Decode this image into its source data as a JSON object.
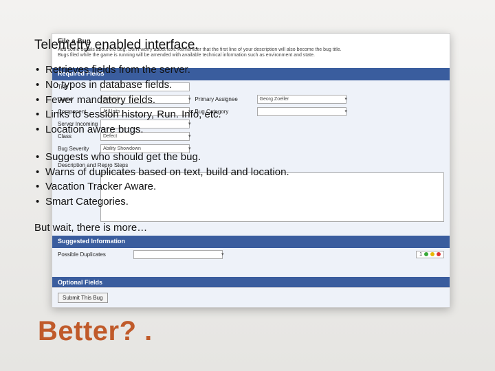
{
  "slide": {
    "title": "Telemetry enabled interface.",
    "bullets_group_1": [
      "Retrieves fields from the server.",
      "No typos in database fields.",
      "Fewer mandatory fields.",
      "Links to session history, Run. Info, etc.",
      "Location aware bugs."
    ],
    "bullets_group_2": [
      "Suggests who should get the bug.",
      "Warns of duplicates based on text, build and location.",
      "Vacation Tracker Aware.",
      "Smart Categories."
    ],
    "more_text": "But wait, there is more…",
    "big_text": "Better? ."
  },
  "bg": {
    "header": "File a Bug",
    "sub1": "Add some details about the bug. Don't worry about text. Remember that the first line of your description will also become the bug title.",
    "sub2": "Bugs filed while the game is running will be amended with available technical information such as environment and state.",
    "sections": {
      "required": "Required Fields",
      "suggested": "Suggested Information",
      "optional": "Optional Fields"
    },
    "labels": {
      "title": "Title",
      "game": "Game",
      "component": "Component",
      "server": "Server Incoming",
      "class": "Class",
      "bugsev": "Bug Severity",
      "assignee": "Primary Assignee",
      "cat": "Bug Category",
      "desc": "Description and Repro Steps"
    },
    "values": {
      "game": "Ganesh",
      "component": "AI/Units",
      "server": "",
      "class": "Defect",
      "bugsev": "Ability Showdown",
      "assignee": "Georg Zoeller",
      "badge_count": "1"
    },
    "buttons": {
      "submit": "Submit This Bug"
    }
  }
}
